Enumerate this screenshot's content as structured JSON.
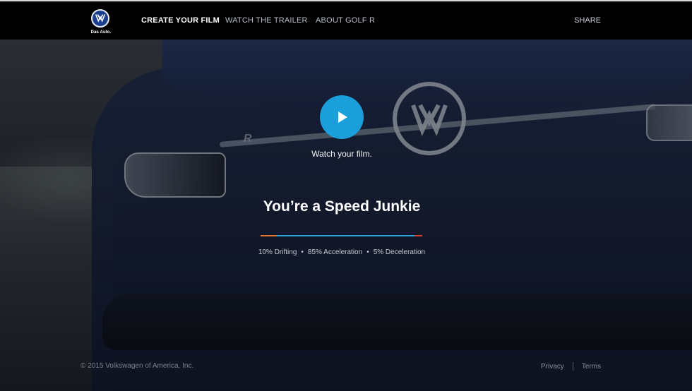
{
  "brand": {
    "logo_text": "Das Auto."
  },
  "nav": {
    "items": [
      {
        "label": "CREATE YOUR FILM",
        "active": true
      },
      {
        "label": "WATCH THE TRAILER",
        "active": false
      },
      {
        "label": "ABOUT GOLF R",
        "active": false
      }
    ],
    "share_label": "SHARE"
  },
  "hero": {
    "play_caption": "Watch your film.",
    "title": "You’re a Speed Junkie",
    "stats": [
      "10% Drifting",
      "85% Acceleration",
      "5% Deceleration"
    ],
    "breakdown": [
      {
        "name": "Drifting",
        "percent": 10,
        "color": "#e8702a"
      },
      {
        "name": "Acceleration",
        "percent": 85,
        "color": "#2a9fd8"
      },
      {
        "name": "Deceleration",
        "percent": 5,
        "color": "#d9402e"
      }
    ],
    "accent_color": "#1a9fda"
  },
  "footer": {
    "copyright": "© 2015 Volkswagen of America, Inc.",
    "links": [
      "Privacy",
      "Terms"
    ]
  }
}
